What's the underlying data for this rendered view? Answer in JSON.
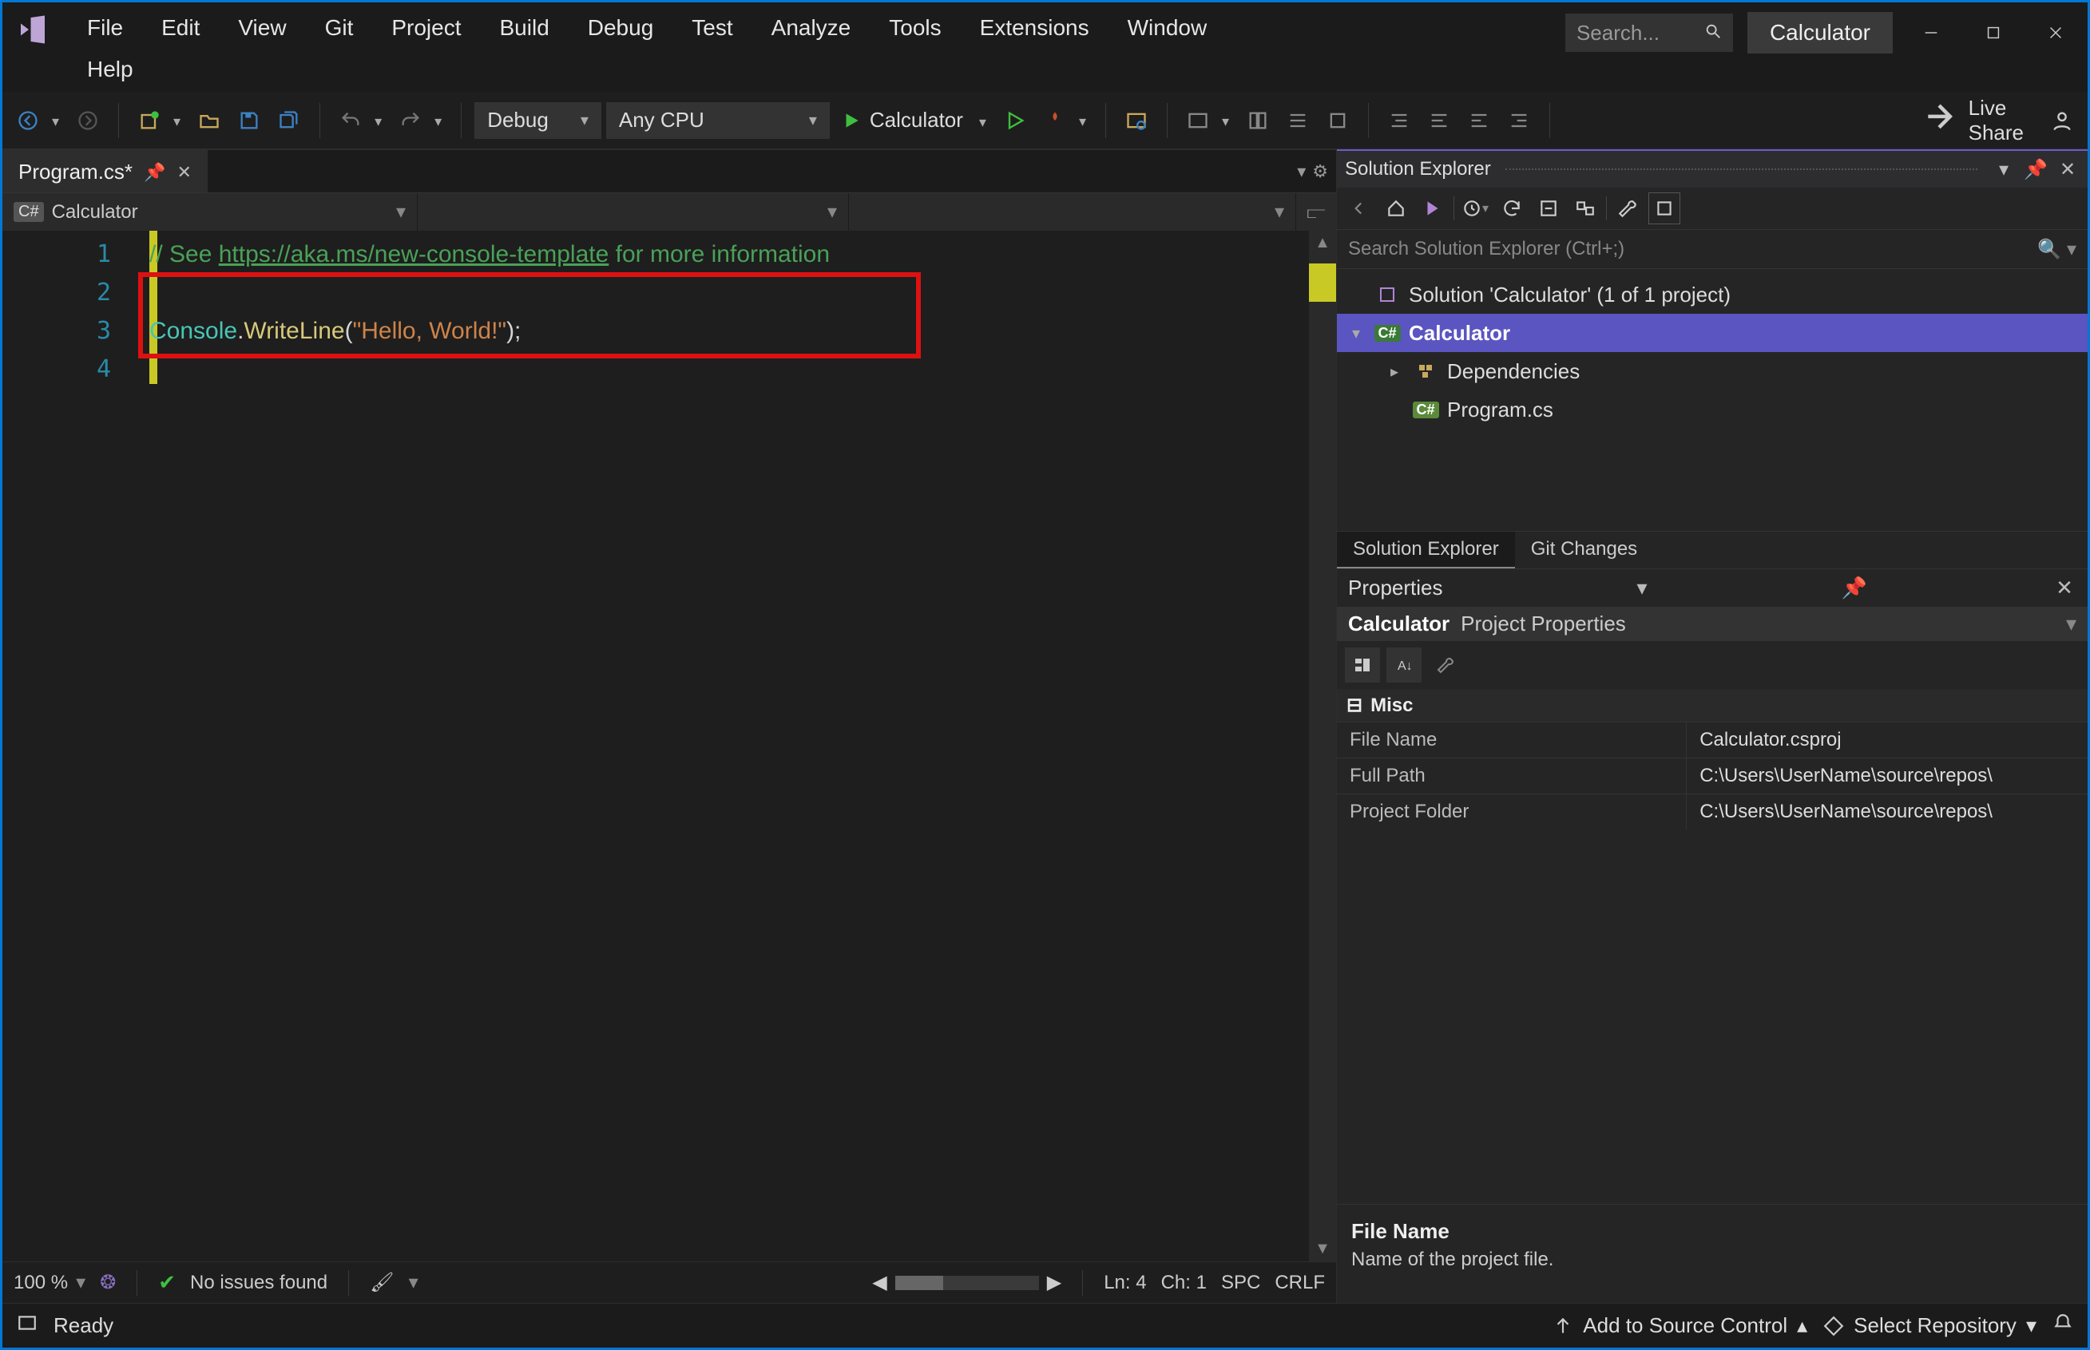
{
  "menu": {
    "items": [
      "File",
      "Edit",
      "View",
      "Git",
      "Project",
      "Build",
      "Debug",
      "Test",
      "Analyze",
      "Tools",
      "Extensions",
      "Window",
      "Help"
    ]
  },
  "title": {
    "search_placeholder": "Search...",
    "app_name": "Calculator"
  },
  "toolbar": {
    "config": "Debug",
    "platform": "Any CPU",
    "start_target": "Calculator",
    "live_share": "Live Share"
  },
  "editor": {
    "tab_name": "Program.cs*",
    "nav_project": "Calculator",
    "code": {
      "comment_prefix": "// See ",
      "comment_link": "https://aka.ms/new-console-template",
      "comment_suffix": " for more information",
      "type": "Console",
      "member": "WriteLine",
      "string": "\"Hello, World!\"",
      "open": "(",
      "close": ");",
      "dot": "."
    },
    "line_numbers": [
      "1",
      "2",
      "3",
      "4"
    ],
    "status": {
      "zoom": "100 %",
      "issues": "No issues found",
      "ln": "Ln: 4",
      "ch": "Ch: 1",
      "ws": "SPC",
      "eol": "CRLF"
    }
  },
  "solution_explorer": {
    "title": "Solution Explorer",
    "search_placeholder": "Search Solution Explorer (Ctrl+;)",
    "solution": "Solution 'Calculator' (1 of 1 project)",
    "project": "Calculator",
    "dependencies": "Dependencies",
    "file": "Program.cs",
    "tabs": {
      "se": "Solution Explorer",
      "git": "Git Changes"
    }
  },
  "properties": {
    "title": "Properties",
    "object": "Calculator",
    "object_type": "Project Properties",
    "category": "Misc",
    "rows": [
      {
        "name": "File Name",
        "value": "Calculator.csproj"
      },
      {
        "name": "Full Path",
        "value": "C:\\Users\\UserName\\source\\repos\\"
      },
      {
        "name": "Project Folder",
        "value": "C:\\Users\\UserName\\source\\repos\\"
      }
    ],
    "desc_title": "File Name",
    "desc_text": "Name of the project file."
  },
  "statusbar": {
    "ready": "Ready",
    "add_src": "Add to Source Control",
    "select_repo": "Select Repository"
  }
}
